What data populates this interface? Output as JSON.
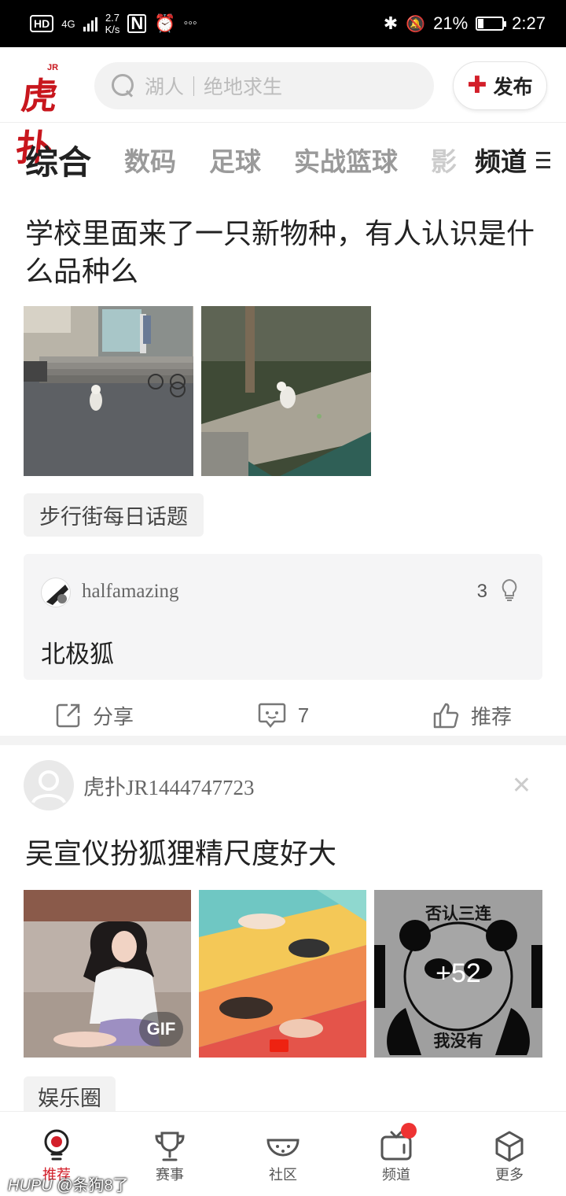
{
  "status_bar": {
    "left_hd": "HD",
    "network": "4G",
    "speed_value": "2.7",
    "speed_unit": "K/s",
    "battery": "21%",
    "time": "2:27"
  },
  "header": {
    "logo_text": "虎扑",
    "logo_jr": "JR",
    "search_placeholder": "湖人｜绝地求生",
    "publish_label": "发布"
  },
  "tabs": {
    "items": [
      "综合",
      "数码",
      "足球",
      "实战篮球",
      "影"
    ],
    "channel_label": "频道"
  },
  "post1": {
    "title": "学校里面来了一只新物种，有人认识是什么品种么",
    "tag": "步行街每日话题",
    "top_comment": {
      "user": "halfamazing",
      "likes": "3",
      "text": "北极狐"
    },
    "actions": {
      "share": "分享",
      "comments": "7",
      "recommend": "推荐"
    }
  },
  "post2": {
    "author": "虎扑JR1444747723",
    "title": "吴宣仪扮狐狸精尺度好大",
    "gif_badge": "GIF",
    "meme_top": "否认三连",
    "meme_bottom": "我没有",
    "more_count": "+52",
    "tag": "娱乐圈"
  },
  "bottom_nav": {
    "items": [
      "推荐",
      "赛事",
      "社区",
      "频道",
      "更多"
    ]
  },
  "watermark": {
    "site": "HUPU",
    "user": "@条狗8了"
  },
  "colors": {
    "brand_red": "#c8161d",
    "accent_red": "#d31f2a",
    "text": "#222222",
    "muted": "#9a9a9a"
  }
}
